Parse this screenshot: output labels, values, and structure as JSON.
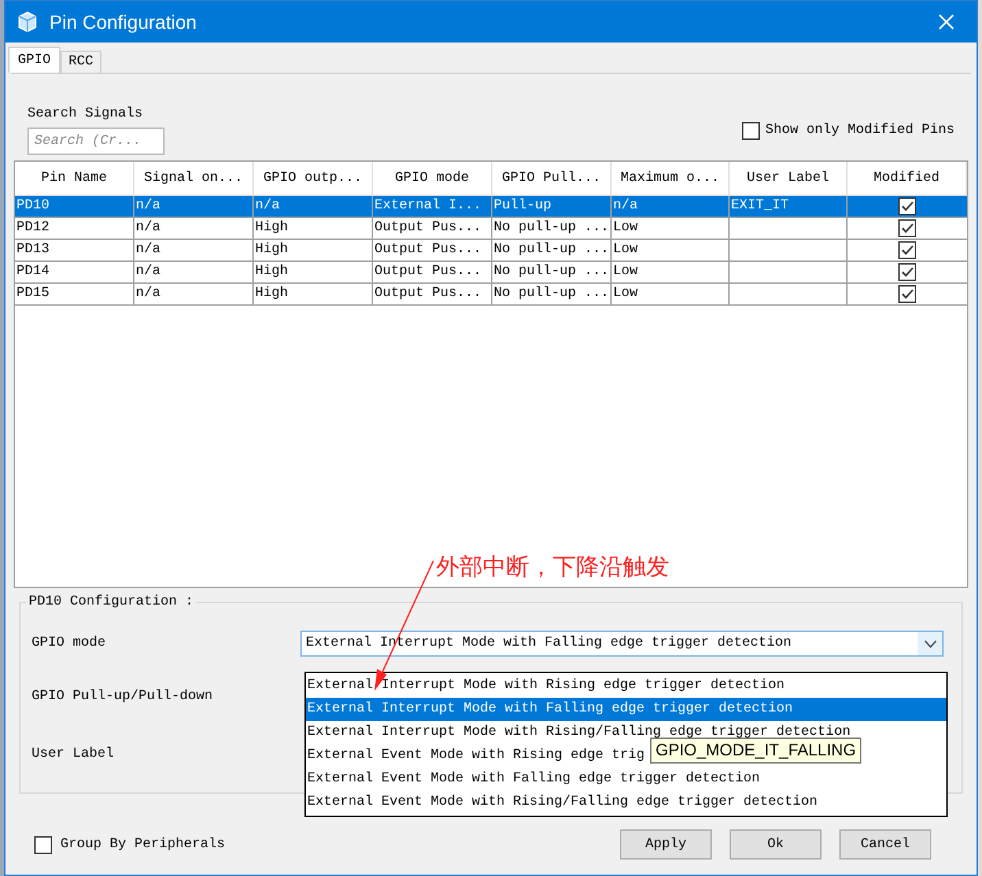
{
  "window": {
    "title": "Pin Configuration"
  },
  "tabs": [
    {
      "label": "GPIO",
      "selected": true
    },
    {
      "label": "RCC",
      "selected": false
    }
  ],
  "search": {
    "label": "Search Signals",
    "placeholder": "Search (Cr..."
  },
  "show_only_modified": {
    "label": "Show only Modified Pins",
    "checked": false
  },
  "table": {
    "columns": [
      "Pin Name",
      "Signal on...",
      "GPIO outp...",
      "GPIO mode",
      "GPIO Pull...",
      "Maximum o...",
      "User Label",
      "Modified"
    ],
    "rows": [
      {
        "cells": [
          "PD10",
          "n/a",
          "n/a",
          "External I...",
          "Pull-up",
          "n/a",
          "EXIT_IT"
        ],
        "modified": true,
        "selected": true
      },
      {
        "cells": [
          "PD12",
          "n/a",
          "High",
          "Output Pus...",
          "No pull-up ...",
          "Low",
          ""
        ],
        "modified": true,
        "selected": false
      },
      {
        "cells": [
          "PD13",
          "n/a",
          "High",
          "Output Pus...",
          "No pull-up ...",
          "Low",
          ""
        ],
        "modified": true,
        "selected": false
      },
      {
        "cells": [
          "PD14",
          "n/a",
          "High",
          "Output Pus...",
          "No pull-up ...",
          "Low",
          ""
        ],
        "modified": true,
        "selected": false
      },
      {
        "cells": [
          "PD15",
          "n/a",
          "High",
          "Output Pus...",
          "No pull-up ...",
          "Low",
          ""
        ],
        "modified": true,
        "selected": false
      }
    ]
  },
  "annotation": "外部中断，下降沿触发",
  "config": {
    "title": "PD10 Configuration :",
    "labels": [
      "GPIO mode",
      "GPIO Pull-up/Pull-down",
      "User Label"
    ],
    "gpio_mode_value": "External Interrupt Mode with Falling edge trigger detection",
    "options": [
      {
        "label": "External Interrupt Mode with Rising edge trigger detection",
        "selected": false
      },
      {
        "label": "External Interrupt Mode with Falling edge trigger detection",
        "selected": true
      },
      {
        "label": "External Interrupt Mode with Rising/Falling edge trigger detection",
        "selected": false
      },
      {
        "label": "External Event Mode with Rising edge trig",
        "selected": false
      },
      {
        "label": "External Event Mode with Falling edge trigger detection",
        "selected": false
      },
      {
        "label": "External Event Mode with Rising/Falling edge trigger detection",
        "selected": false
      }
    ],
    "tooltip": "GPIO_MODE_IT_FALLING"
  },
  "group_by_peripherals": {
    "label": "Group By Peripherals",
    "checked": false
  },
  "buttons": [
    "Apply",
    "Ok",
    "Cancel"
  ]
}
